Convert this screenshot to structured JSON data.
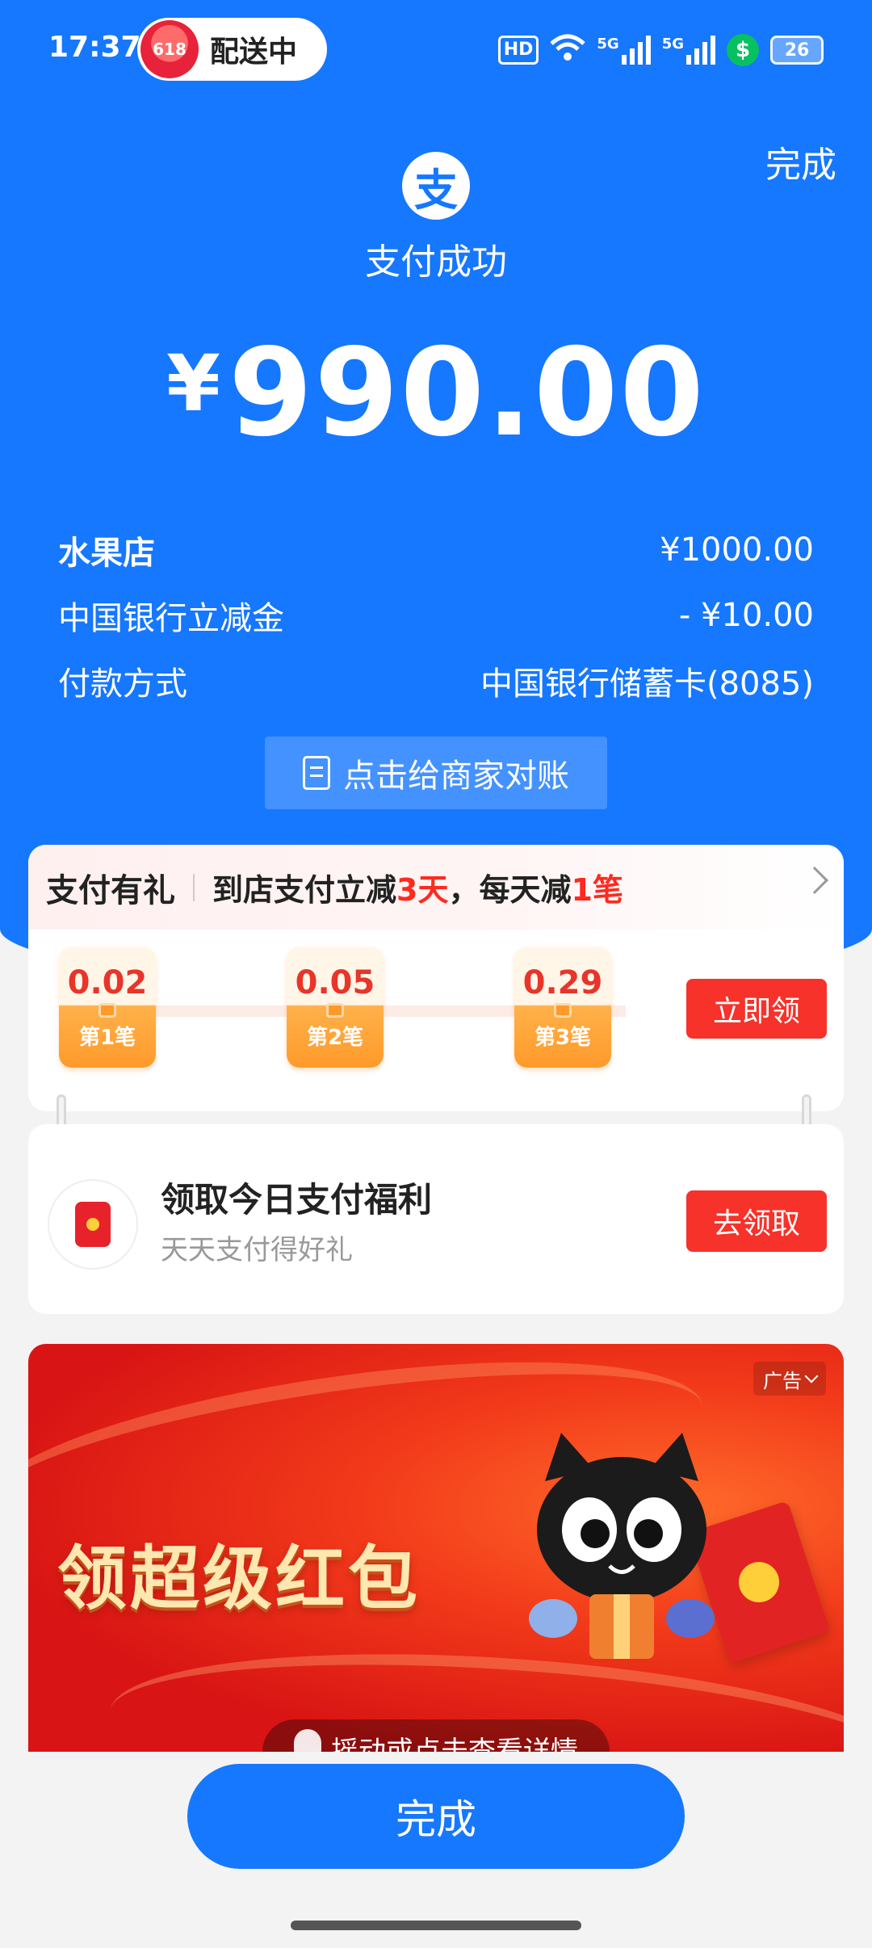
{
  "status_bar": {
    "time": "17:37",
    "delivery_badge": "618",
    "delivery_text": "配送中",
    "hd_label": "HD",
    "network_1": "5G",
    "network_2": "5G",
    "battery": "26"
  },
  "header": {
    "done_label": "完成",
    "logo_char": "支",
    "title": "支付成功",
    "currency": "¥",
    "amount": "990.00"
  },
  "details": [
    {
      "label": "水果店",
      "value": "¥1000.00"
    },
    {
      "label": "中国银行立减金",
      "value": "- ¥10.00"
    },
    {
      "label": "付款方式",
      "value": "中国银行储蓄卡(8085)"
    }
  ],
  "reconcile_button": "点击给商家对账",
  "reward": {
    "title": "支付有礼",
    "desc_prefix": "到店支付立减",
    "desc_days": "3天",
    "desc_mid": "，每天减",
    "desc_count": "1笔",
    "coupons": [
      {
        "value": "0.02",
        "label": "第1笔"
      },
      {
        "value": "0.05",
        "label": "第2笔"
      },
      {
        "value": "0.29",
        "label": "第3笔"
      }
    ],
    "claim_button": "立即领"
  },
  "welfare": {
    "title": "领取今日支付福利",
    "subtitle": "天天支付得好礼",
    "button": "去领取"
  },
  "ad": {
    "tag": "广告",
    "headline": "领超级红包",
    "pill_text": "摇动或点击查看详情"
  },
  "bottom": {
    "done_button": "完成"
  },
  "colors": {
    "brand_blue": "#1677ff",
    "accent_red": "#f6322a"
  }
}
